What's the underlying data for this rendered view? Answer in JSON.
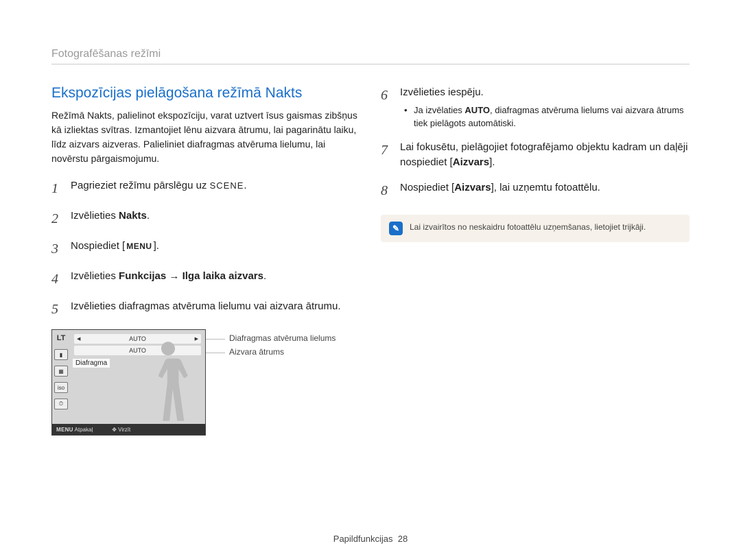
{
  "breadcrumb": "Fotografēšanas režīmi",
  "section_title": "Ekspozīcijas pielāgošana režīmā Nakts",
  "intro": "Režīmā Nakts, palielinot ekspozīciju, varat uztvert īsus gaismas zibšņus kā izliektas svītras. Izmantojiet lēnu aizvara ātrumu, lai pagarinātu laiku, līdz aizvars aizveras. Palieliniet diafragmas atvēruma lielumu, lai novērstu pārgaismojumu.",
  "steps_left": {
    "s1_pre": "Pagrieziet režīmu pārslēgu uz ",
    "s1_scene": "SCENE",
    "s1_post": ".",
    "s2_pre": "Izvēlieties ",
    "s2_bold": "Nakts",
    "s2_post": ".",
    "s3_pre": "Nospiediet [",
    "s3_menu": "MENU",
    "s3_post": "].",
    "s4_pre": "Izvēlieties ",
    "s4_bold_a": "Funkcijas",
    "s4_arrow": " → ",
    "s4_bold_b": "Ilga laika aizvars",
    "s4_post": ".",
    "s5": "Izvēlieties diafragmas atvēruma lielumu vai aizvara ātrumu."
  },
  "steps_right": {
    "s6": "Izvēlieties iespēju.",
    "s6_sub_pre": "Ja izvēlaties ",
    "s6_sub_bold": "AUTO",
    "s6_sub_post": ", diafragmas atvēruma lielums vai aizvara ātrums tiek pielāgots automātiski.",
    "s7_pre": "Lai fokusētu, pielāgojiet fotografējamo objektu kadram un daļēji nospiediet [",
    "s7_bold": "Aizvars",
    "s7_post": "].",
    "s8_pre": "Nospiediet [",
    "s8_bold": "Aizvars",
    "s8_post": "], lai uzņemtu fotoattēlu."
  },
  "tip": "Lai izvairītos no neskaidru fotoattēlu uzņemšanas, lietojiet trijkāji.",
  "lcd": {
    "lt": "LT",
    "diafragma": "Diafragma",
    "row1_val": "AUTO",
    "row2_val": "AUTO",
    "footer_menu": "MENU",
    "footer_back": "Atpakaļ",
    "footer_move": "Virzīt"
  },
  "callout1": "Diafragmas atvēruma lielums",
  "callout2": "Aizvara ātrums",
  "footer_label": "Papildfunkcijas",
  "footer_page": "28"
}
